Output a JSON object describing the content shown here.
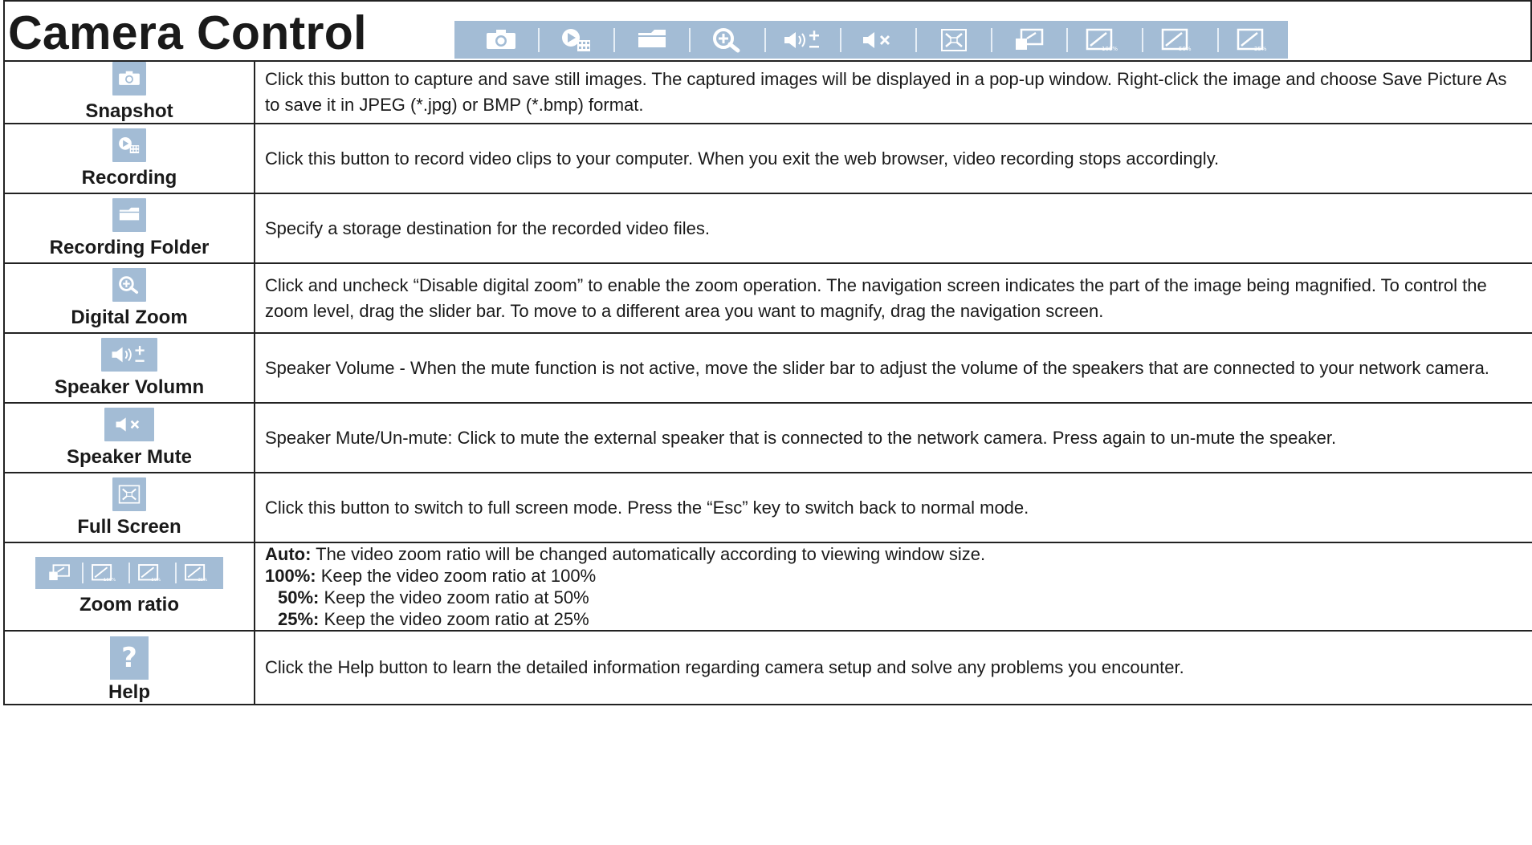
{
  "title": "Camera Control",
  "colors": {
    "button_bg": "#a3bcd5",
    "icon": "#ffffff",
    "border": "#222222"
  },
  "toolbar": {
    "icons": [
      "camera-icon",
      "record-icon",
      "folder-icon",
      "zoom-in-icon",
      "volume-icon",
      "mute-icon",
      "fullscreen-icon",
      "zoom-auto-icon",
      "zoom-100-icon",
      "zoom-50-icon",
      "zoom-25-icon"
    ],
    "zoom_labels": [
      "100%",
      "50%",
      "25%"
    ]
  },
  "rows": [
    {
      "label": "Snapshot",
      "icon": "camera-icon",
      "desc": "Click this button to capture and save still images. The captured images will be displayed in a pop-up window. Right-click the image and choose Save Picture As to save it in JPEG (*.jpg) or BMP (*.bmp) format."
    },
    {
      "label": "Recording",
      "icon": "record-icon",
      "desc": "Click this button to record video clips to your computer. When you exit the web browser, video recording stops accordingly."
    },
    {
      "label": "Recording Folder",
      "icon": "folder-icon",
      "desc": "Specify a storage destination for the recorded video files."
    },
    {
      "label": "Digital Zoom",
      "icon": "zoom-in-icon",
      "desc": "Click and uncheck “Disable digital zoom” to enable the zoom operation. The navigation screen indicates the part of the image being magnified. To control the zoom level, drag the slider bar. To move to a different area you want to magnify, drag the navigation screen."
    },
    {
      "label": "Speaker Volumn",
      "icon": "volume-icon",
      "desc": "Speaker Volume - When the mute function is not active, move the slider bar to adjust the volume of the speakers that are connected to your network camera."
    },
    {
      "label": "Speaker Mute",
      "icon": "mute-icon",
      "desc": "Speaker Mute/Un-mute: Click to mute the external speaker that is connected to the network camera. Press again to un-mute the speaker."
    },
    {
      "label": "Full Screen",
      "icon": "fullscreen-icon",
      "desc": "Click this button to switch to full screen mode. Press the “Esc” key to switch back to normal mode."
    },
    {
      "label": "Zoom ratio",
      "icon": "zoom-ratio-icons",
      "items": [
        {
          "key": "Auto:",
          "text": " The video zoom ratio will be changed automatically according to viewing window size."
        },
        {
          "key": "100%:",
          "text": " Keep the video zoom ratio at 100%"
        },
        {
          "key": "50%:",
          "text": " Keep the video zoom ratio at 50%"
        },
        {
          "key": "25%:",
          "text": " Keep the video zoom ratio at 25%"
        }
      ]
    },
    {
      "label": "Help",
      "icon": "help-icon",
      "help_glyph": "?",
      "desc": "Click the Help button to learn the detailed information regarding camera setup and solve any problems you encounter."
    }
  ]
}
